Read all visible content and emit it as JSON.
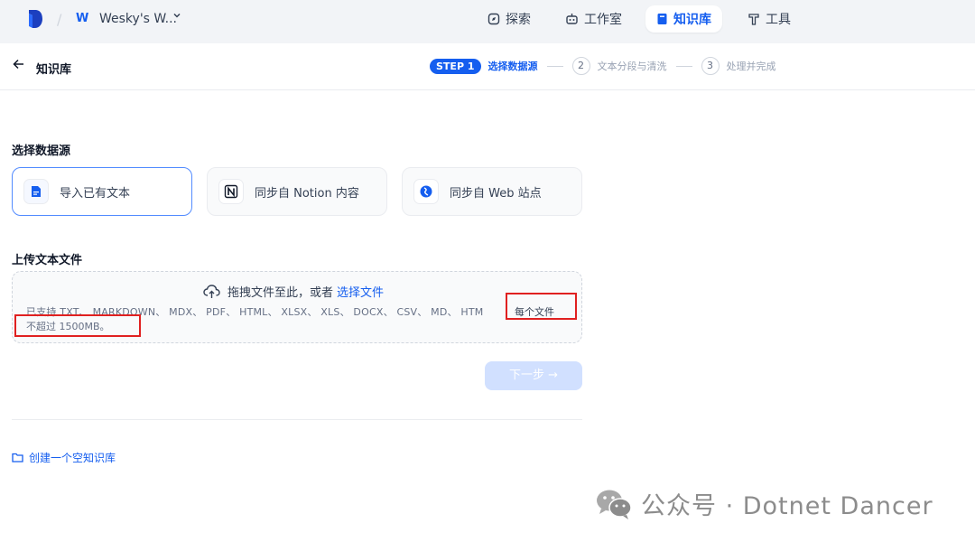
{
  "topbar": {
    "workspace_badge": "W",
    "workspace_name": "Wesky's W...",
    "nav": [
      {
        "label": "探索",
        "icon": "compass-icon",
        "active": false
      },
      {
        "label": "工作室",
        "icon": "robot-icon",
        "active": false
      },
      {
        "label": "知识库",
        "icon": "book-icon",
        "active": true
      },
      {
        "label": "工具",
        "icon": "hammer-icon",
        "active": false
      }
    ]
  },
  "subheader": {
    "back_label": "知识库",
    "steps": {
      "step1_pill": "STEP 1",
      "step1_label": "选择数据源",
      "step2_num": "2",
      "step2_label": "文本分段与清洗",
      "step3_num": "3",
      "step3_label": "处理并完成"
    }
  },
  "content": {
    "source_title": "选择数据源",
    "sources": [
      {
        "label": "导入已有文本",
        "icon": "document-icon",
        "selected": true
      },
      {
        "label": "同步自 Notion 内容",
        "icon": "notion-icon",
        "selected": false
      },
      {
        "label": "同步自 Web 站点",
        "icon": "globe-icon",
        "selected": false
      }
    ],
    "upload_title": "上传文本文件",
    "dropzone": {
      "text": "拖拽文件至此，或者",
      "link": "选择文件",
      "hint": "已支持 TXT、 MARKDOWN、 MDX、 PDF、 HTML、 XLSX、 XLS、 DOCX、 CSV、 MD、 HTM",
      "per_file": "每个文件",
      "limit": "不超过 1500MB。"
    },
    "next_button": "下一步 →",
    "create_empty": "创建一个空知识库"
  },
  "watermark": "公众号 · Dotnet Dancer",
  "colors": {
    "accent": "#155eef",
    "annotation_red": "#e02020"
  }
}
